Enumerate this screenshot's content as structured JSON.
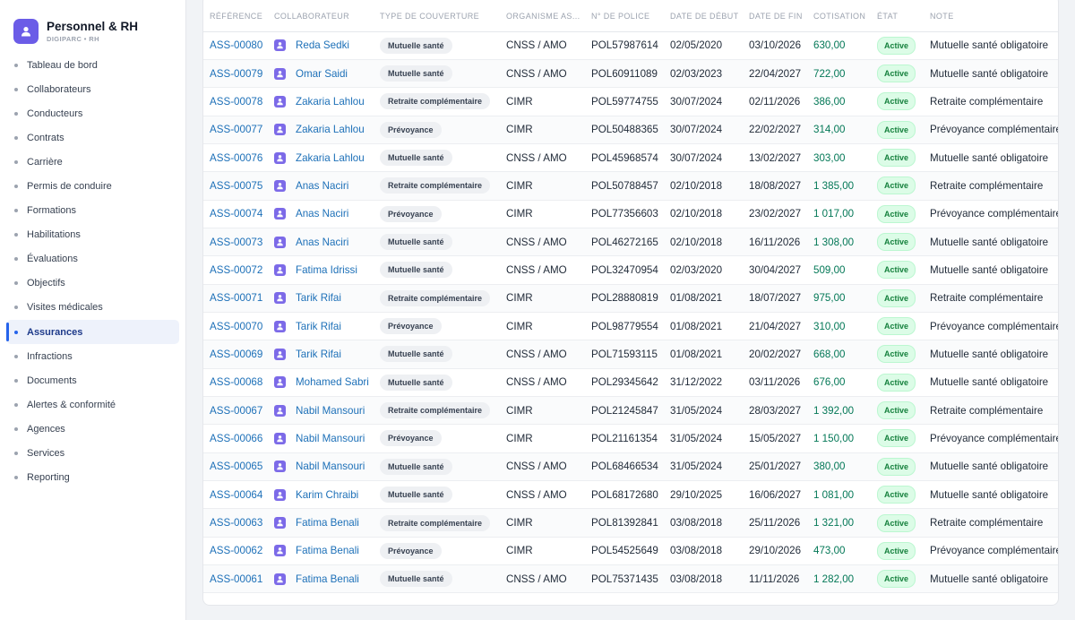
{
  "app": {
    "title": "Personnel & RH",
    "subtitle": "DIGIPARC • RH",
    "logo_color": "#6b5ce7",
    "accent_color": "#2563eb"
  },
  "sidebar": {
    "items": [
      {
        "label": "Tableau de bord",
        "active": false
      },
      {
        "label": "Collaborateurs",
        "active": false
      },
      {
        "label": "Conducteurs",
        "active": false
      },
      {
        "label": "Contrats",
        "active": false
      },
      {
        "label": "Carrière",
        "active": false
      },
      {
        "label": "Permis de conduire",
        "active": false
      },
      {
        "label": "Formations",
        "active": false
      },
      {
        "label": "Habilitations",
        "active": false
      },
      {
        "label": "Évaluations",
        "active": false
      },
      {
        "label": "Objectifs",
        "active": false
      },
      {
        "label": "Visites médicales",
        "active": false
      },
      {
        "label": "Assurances",
        "active": true
      },
      {
        "label": "Infractions",
        "active": false
      },
      {
        "label": "Documents",
        "active": false
      },
      {
        "label": "Alertes & conformité",
        "active": false
      },
      {
        "label": "Agences",
        "active": false
      },
      {
        "label": "Services",
        "active": false
      },
      {
        "label": "Reporting",
        "active": false
      }
    ]
  },
  "table": {
    "headers": [
      "RÉFÉRENCE",
      "COLLABORATEUR",
      "TYPE DE COUVERTURE",
      "ORGANISME AS...",
      "N° DE POLICE",
      "DATE DE DÉBUT",
      "DATE DE FIN",
      "COTISATION",
      "ÉTAT",
      "NOTE"
    ],
    "rows": [
      {
        "ref": "ASS-00080",
        "collab": "Reda Sedki",
        "type": "Mutuelle santé",
        "org": "CNSS / AMO",
        "police": "POL57987614",
        "debut": "02/05/2020",
        "fin": "03/10/2026",
        "cotisation": "630,00",
        "etat": "Active",
        "note": "Mutuelle santé obligatoire"
      },
      {
        "ref": "ASS-00079",
        "collab": "Omar Saidi",
        "type": "Mutuelle santé",
        "org": "CNSS / AMO",
        "police": "POL60911089",
        "debut": "02/03/2023",
        "fin": "22/04/2027",
        "cotisation": "722,00",
        "etat": "Active",
        "note": "Mutuelle santé obligatoire"
      },
      {
        "ref": "ASS-00078",
        "collab": "Zakaria Lahlou",
        "type": "Retraite complémentaire",
        "org": "CIMR",
        "police": "POL59774755",
        "debut": "30/07/2024",
        "fin": "02/11/2026",
        "cotisation": "386,00",
        "etat": "Active",
        "note": "Retraite complémentaire"
      },
      {
        "ref": "ASS-00077",
        "collab": "Zakaria Lahlou",
        "type": "Prévoyance",
        "org": "CIMR",
        "police": "POL50488365",
        "debut": "30/07/2024",
        "fin": "22/02/2027",
        "cotisation": "314,00",
        "etat": "Active",
        "note": "Prévoyance complémentaire"
      },
      {
        "ref": "ASS-00076",
        "collab": "Zakaria Lahlou",
        "type": "Mutuelle santé",
        "org": "CNSS / AMO",
        "police": "POL45968574",
        "debut": "30/07/2024",
        "fin": "13/02/2027",
        "cotisation": "303,00",
        "etat": "Active",
        "note": "Mutuelle santé obligatoire"
      },
      {
        "ref": "ASS-00075",
        "collab": "Anas Naciri",
        "type": "Retraite complémentaire",
        "org": "CIMR",
        "police": "POL50788457",
        "debut": "02/10/2018",
        "fin": "18/08/2027",
        "cotisation": "1 385,00",
        "etat": "Active",
        "note": "Retraite complémentaire"
      },
      {
        "ref": "ASS-00074",
        "collab": "Anas Naciri",
        "type": "Prévoyance",
        "org": "CIMR",
        "police": "POL77356603",
        "debut": "02/10/2018",
        "fin": "23/02/2027",
        "cotisation": "1 017,00",
        "etat": "Active",
        "note": "Prévoyance complémentaire"
      },
      {
        "ref": "ASS-00073",
        "collab": "Anas Naciri",
        "type": "Mutuelle santé",
        "org": "CNSS / AMO",
        "police": "POL46272165",
        "debut": "02/10/2018",
        "fin": "16/11/2026",
        "cotisation": "1 308,00",
        "etat": "Active",
        "note": "Mutuelle santé obligatoire"
      },
      {
        "ref": "ASS-00072",
        "collab": "Fatima Idrissi",
        "type": "Mutuelle santé",
        "org": "CNSS / AMO",
        "police": "POL32470954",
        "debut": "02/03/2020",
        "fin": "30/04/2027",
        "cotisation": "509,00",
        "etat": "Active",
        "note": "Mutuelle santé obligatoire"
      },
      {
        "ref": "ASS-00071",
        "collab": "Tarik Rifai",
        "type": "Retraite complémentaire",
        "org": "CIMR",
        "police": "POL28880819",
        "debut": "01/08/2021",
        "fin": "18/07/2027",
        "cotisation": "975,00",
        "etat": "Active",
        "note": "Retraite complémentaire"
      },
      {
        "ref": "ASS-00070",
        "collab": "Tarik Rifai",
        "type": "Prévoyance",
        "org": "CIMR",
        "police": "POL98779554",
        "debut": "01/08/2021",
        "fin": "21/04/2027",
        "cotisation": "310,00",
        "etat": "Active",
        "note": "Prévoyance complémentaire"
      },
      {
        "ref": "ASS-00069",
        "collab": "Tarik Rifai",
        "type": "Mutuelle santé",
        "org": "CNSS / AMO",
        "police": "POL71593115",
        "debut": "01/08/2021",
        "fin": "20/02/2027",
        "cotisation": "668,00",
        "etat": "Active",
        "note": "Mutuelle santé obligatoire"
      },
      {
        "ref": "ASS-00068",
        "collab": "Mohamed Sabri",
        "type": "Mutuelle santé",
        "org": "CNSS / AMO",
        "police": "POL29345642",
        "debut": "31/12/2022",
        "fin": "03/11/2026",
        "cotisation": "676,00",
        "etat": "Active",
        "note": "Mutuelle santé obligatoire"
      },
      {
        "ref": "ASS-00067",
        "collab": "Nabil Mansouri",
        "type": "Retraite complémentaire",
        "org": "CIMR",
        "police": "POL21245847",
        "debut": "31/05/2024",
        "fin": "28/03/2027",
        "cotisation": "1 392,00",
        "etat": "Active",
        "note": "Retraite complémentaire"
      },
      {
        "ref": "ASS-00066",
        "collab": "Nabil Mansouri",
        "type": "Prévoyance",
        "org": "CIMR",
        "police": "POL21161354",
        "debut": "31/05/2024",
        "fin": "15/05/2027",
        "cotisation": "1 150,00",
        "etat": "Active",
        "note": "Prévoyance complémentaire"
      },
      {
        "ref": "ASS-00065",
        "collab": "Nabil Mansouri",
        "type": "Mutuelle santé",
        "org": "CNSS / AMO",
        "police": "POL68466534",
        "debut": "31/05/2024",
        "fin": "25/01/2027",
        "cotisation": "380,00",
        "etat": "Active",
        "note": "Mutuelle santé obligatoire"
      },
      {
        "ref": "ASS-00064",
        "collab": "Karim Chraibi",
        "type": "Mutuelle santé",
        "org": "CNSS / AMO",
        "police": "POL68172680",
        "debut": "29/10/2025",
        "fin": "16/06/2027",
        "cotisation": "1 081,00",
        "etat": "Active",
        "note": "Mutuelle santé obligatoire"
      },
      {
        "ref": "ASS-00063",
        "collab": "Fatima Benali",
        "type": "Retraite complémentaire",
        "org": "CIMR",
        "police": "POL81392841",
        "debut": "03/08/2018",
        "fin": "25/11/2026",
        "cotisation": "1 321,00",
        "etat": "Active",
        "note": "Retraite complémentaire"
      },
      {
        "ref": "ASS-00062",
        "collab": "Fatima Benali",
        "type": "Prévoyance",
        "org": "CIMR",
        "police": "POL54525649",
        "debut": "03/08/2018",
        "fin": "29/10/2026",
        "cotisation": "473,00",
        "etat": "Active",
        "note": "Prévoyance complémentaire"
      },
      {
        "ref": "ASS-00061",
        "collab": "Fatima Benali",
        "type": "Mutuelle santé",
        "org": "CNSS / AMO",
        "police": "POL75371435",
        "debut": "03/08/2018",
        "fin": "11/11/2026",
        "cotisation": "1 282,00",
        "etat": "Active",
        "note": "Mutuelle santé obligatoire"
      }
    ]
  }
}
